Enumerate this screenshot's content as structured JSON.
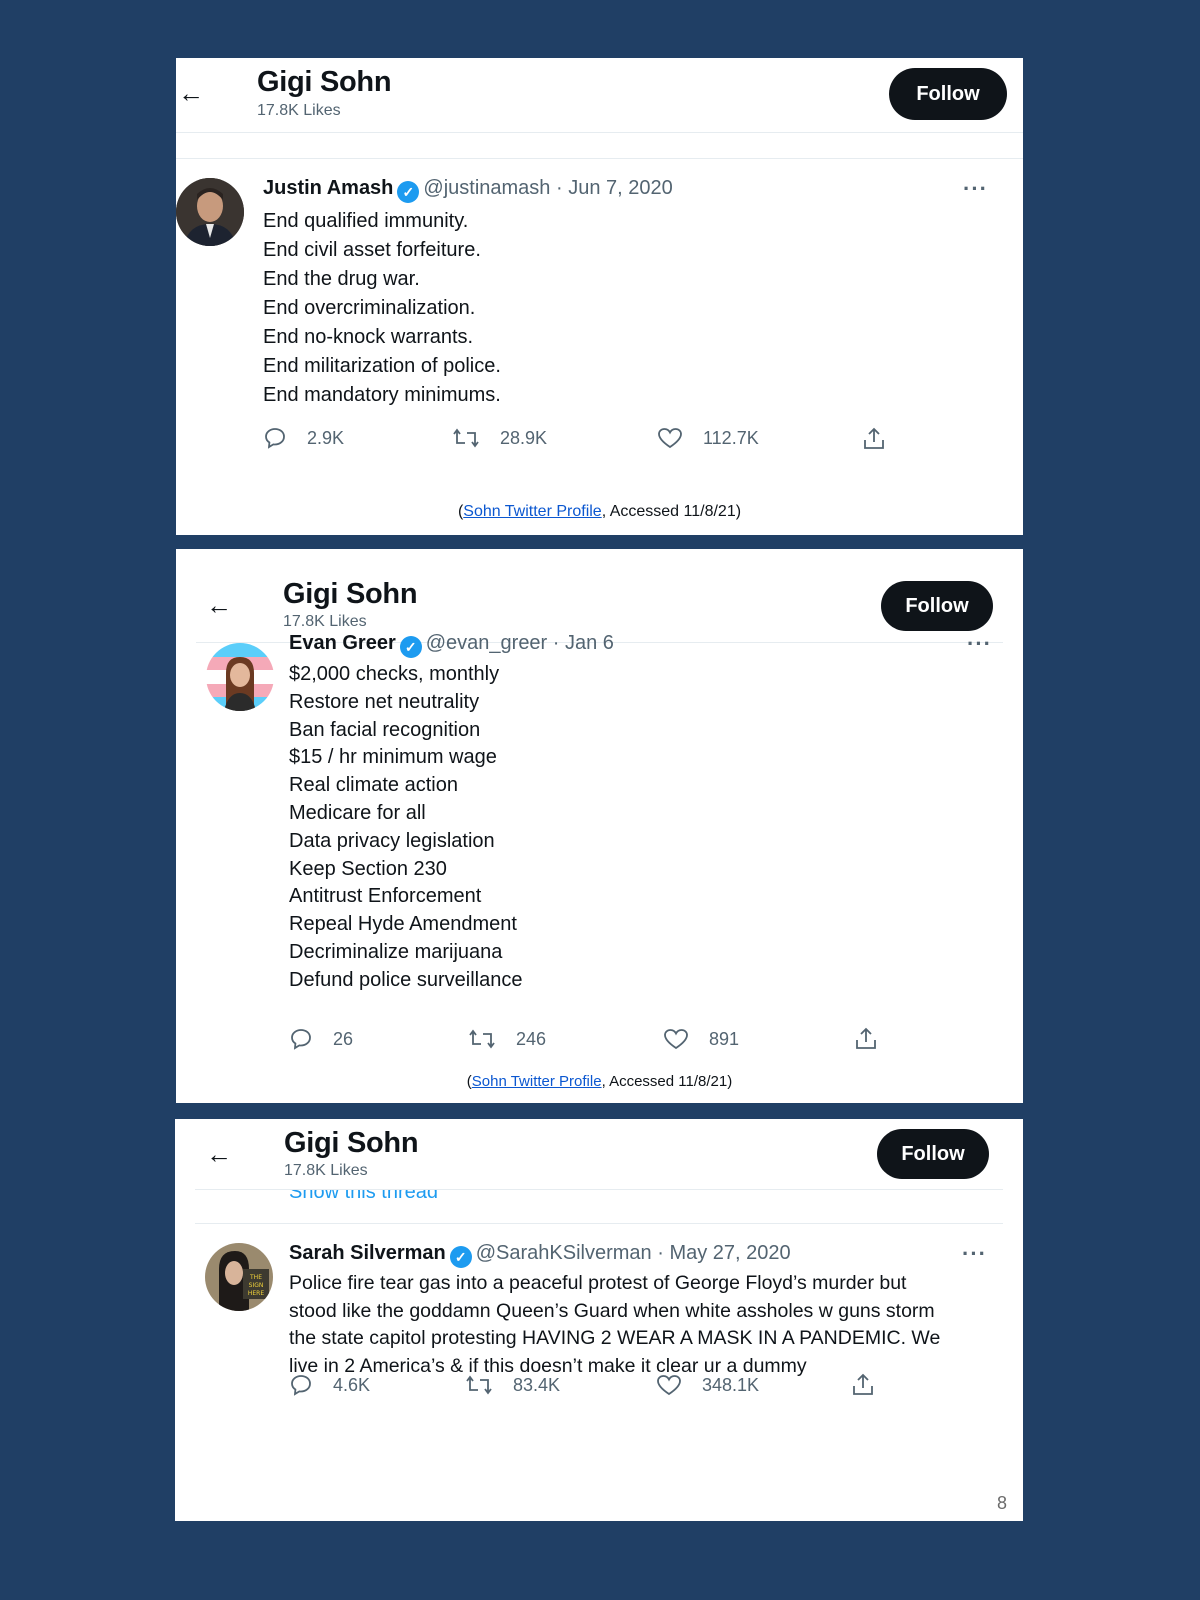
{
  "profile_header": {
    "name": "Gigi Sohn",
    "likes": "17.8K Likes",
    "follow_label": "Follow",
    "back_icon": "←"
  },
  "tweets": [
    {
      "author": "Justin Amash",
      "handle": "@justinamash · Jun 7, 2020",
      "lines": [
        "End qualified immunity.",
        "End civil asset forfeiture.",
        "End the drug war.",
        "End overcriminalization.",
        "End no-knock warrants.",
        "End militarization of police.",
        "End mandatory minimums."
      ],
      "replies": "2.9K",
      "retweets": "28.9K",
      "likes": "112.7K",
      "source_link": "Sohn Twitter Profile",
      "source_rest": ", Accessed 11/8/21)",
      "source_open": "("
    },
    {
      "author": "Evan Greer",
      "handle": "@evan_greer · Jan 6",
      "lines": [
        "$2,000 checks, monthly",
        "Restore net neutrality",
        "Ban facial recognition",
        "$15 / hr minimum wage",
        "Real climate action",
        "Medicare for all",
        "Data privacy legislation",
        "Keep Section 230",
        "Antitrust Enforcement",
        "Repeal Hyde Amendment",
        "Decriminalize marijuana",
        "Defund police surveillance"
      ],
      "replies": "26",
      "retweets": "246",
      "likes": "891",
      "source_link": "Sohn Twitter Profile",
      "source_rest": ", Accessed 11/8/21)",
      "source_open": "("
    },
    {
      "author": "Sarah Silverman",
      "handle": "@SarahKSilverman · May 27, 2020",
      "partial_above": "Show this thread",
      "lines": [
        "Police fire tear gas into a peaceful protest of George Floyd’s murder but",
        "stood like the goddamn Queen’s Guard when white assholes w guns storm",
        "the state capitol protesting HAVING 2 WEAR A MASK IN A PANDEMIC. We",
        "live in 2 America’s & if this doesn’t make it clear ur a dummy"
      ],
      "replies": "4.6K",
      "retweets": "83.4K",
      "likes": "348.1K"
    }
  ],
  "page_number": "8",
  "icons": [
    "back-arrow-icon",
    "verified-icon",
    "more-icon",
    "reply-icon",
    "retweet-icon",
    "like-icon",
    "share-icon"
  ],
  "colors": {
    "background": "#203f65",
    "accent": "#1d9bf0",
    "button": "#0f1419"
  }
}
